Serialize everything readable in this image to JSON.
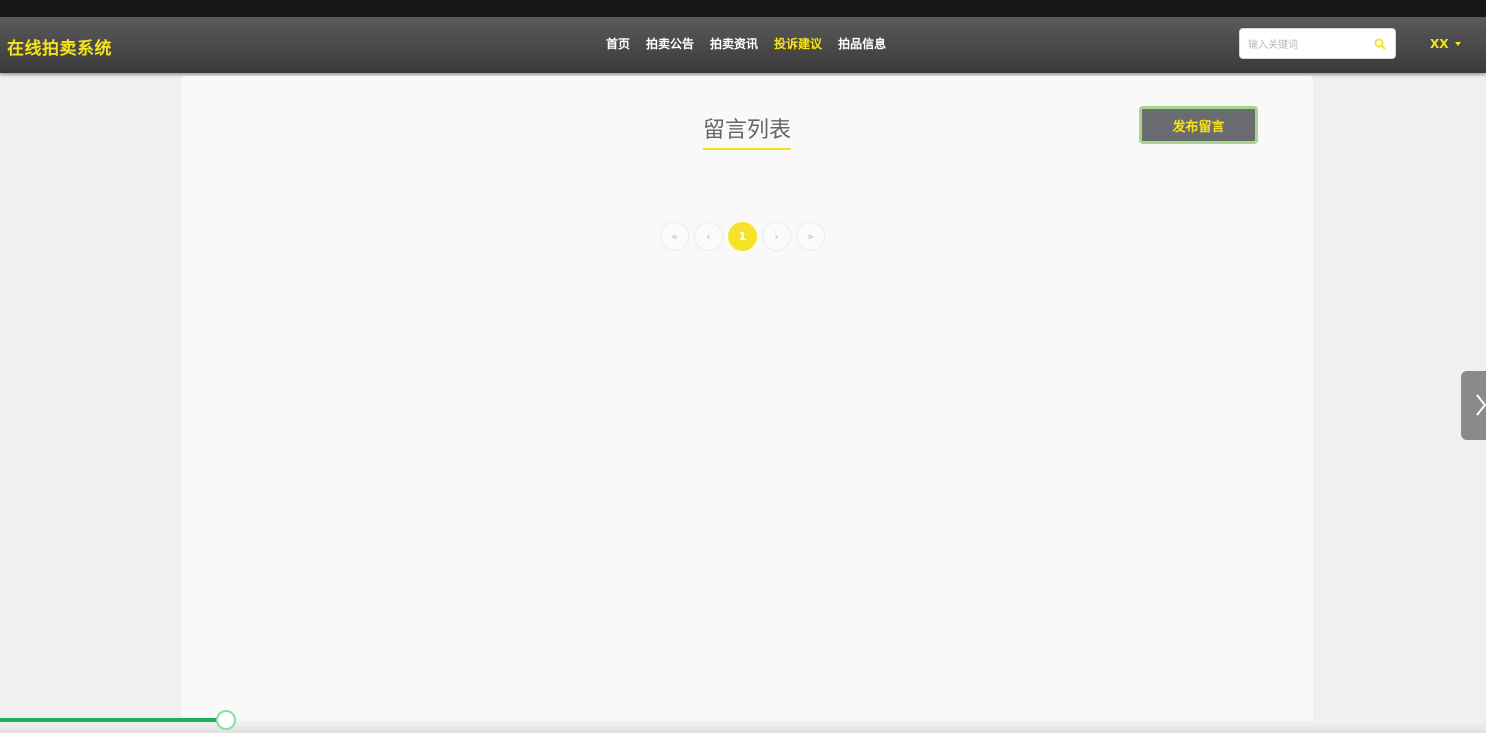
{
  "brand": "在线拍卖系统",
  "nav": {
    "items": [
      "首页",
      "拍卖公告",
      "拍卖资讯",
      "投诉建议",
      "拍品信息"
    ],
    "active_index": 3
  },
  "search": {
    "placeholder": "输入关键词",
    "icon": "search-icon"
  },
  "user": {
    "name": "XX"
  },
  "main": {
    "title": "留言列表",
    "post_button": "发布留言"
  },
  "pagination": {
    "first": "«",
    "prev": "‹",
    "current": "1",
    "next": "›",
    "last": "»"
  },
  "video_progress": {
    "fraction": 0.15
  },
  "colors": {
    "accent": "#f5e21a",
    "navbar": "#4a4a4a",
    "button_bg": "#6b6b72",
    "button_border": "#a6d58c",
    "progress": "#14b457"
  }
}
